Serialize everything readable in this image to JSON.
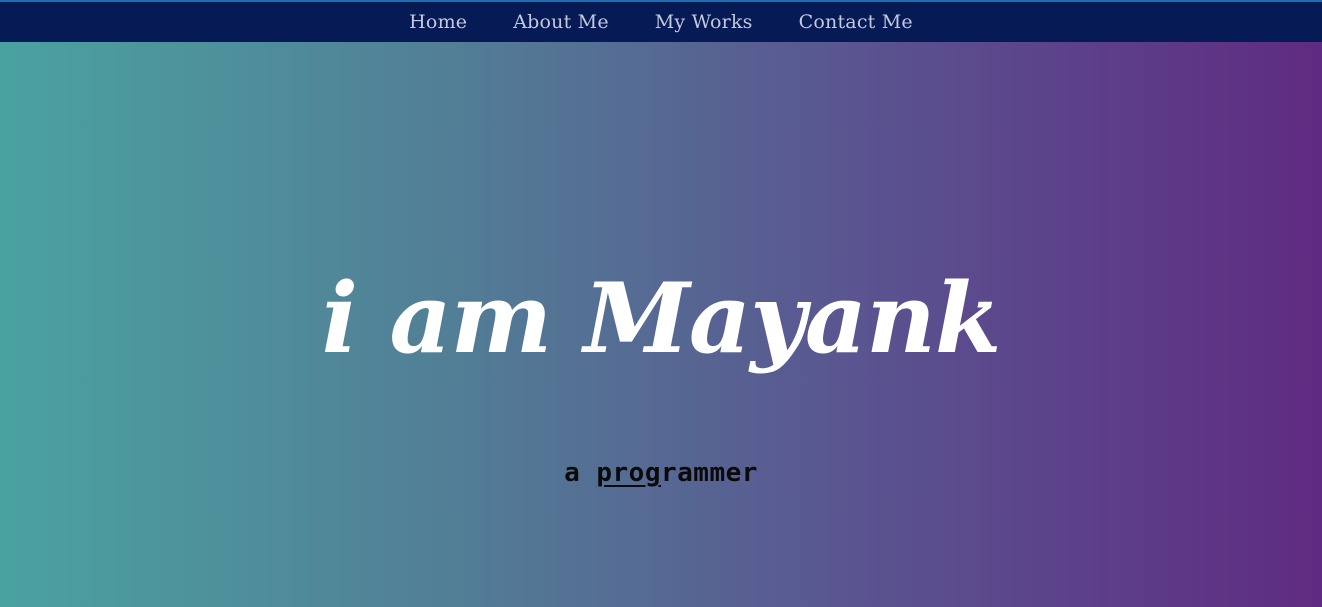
{
  "nav": {
    "items": [
      {
        "label": "Home"
      },
      {
        "label": "About Me"
      },
      {
        "label": "My Works"
      },
      {
        "label": "Contact Me"
      }
    ]
  },
  "hero": {
    "title": "i am Mayank",
    "subtitle_prefix": "a ",
    "subtitle_underlined": "prog",
    "subtitle_rest": "rammer"
  },
  "colors": {
    "navbar_bg": "#061a56",
    "gradient_start": "#4aa2a0",
    "gradient_end": "#5f2b82",
    "title_color": "#ffffff",
    "subtitle_color": "#0a0a0a"
  }
}
